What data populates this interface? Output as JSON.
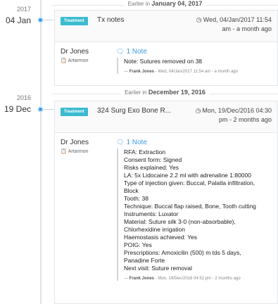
{
  "groups": [
    {
      "year": "2017",
      "day": "04 Jan",
      "separator_prefix": "Earlier in",
      "separator_date": "January 04, 2017",
      "entry": {
        "badge": "Treatment",
        "title": "Tx notes",
        "time_line1": "Wed, 04/Jan/2017 11:54",
        "time_line2": "am - a month ago",
        "author": "Dr Jones",
        "location": "Artarmon",
        "note_count": "1 Note",
        "note_lines": [
          "Note: Sutures removed on 38"
        ],
        "note_author": "Frank Jones",
        "note_meta": " - Wed, 04/Jan/2017 11:54 am - a month ago"
      }
    },
    {
      "year": "2016",
      "day": "19 Dec",
      "separator_prefix": "Earlier in",
      "separator_date": "December 19, 2016",
      "entry": {
        "badge": "Treatment",
        "title": "324 Surg Exo Bone R...",
        "time_line1": "Mon, 19/Dec/2016 04:30",
        "time_line2": "pm - 2 months ago",
        "author": "Dr Jones",
        "location": "Artarmon",
        "note_count": "1 Note",
        "note_lines": [
          "RFA: Extraction",
          "Consent form: Signed",
          "Risks explained: Yes",
          "LA: 5x Lidocaine 2.2 ml with adrenaline 1:80000",
          "Type of injection given: Buccal, Palatla infiltration,",
          "Block",
          "Tooth: 38",
          "Technique: Buccal flap raised, Bone, Tooth cutting",
          "Instruments: Luxator",
          "Material: Suture silk 3-0 (non-absorbable),",
          "Chlorhexidine irrigation",
          "Haemostasis achieved: Yes",
          "POIG: Yes",
          "Prescriptions: Amoxicilin (500) m tds 5 days,",
          "Panadine Forte",
          "Next visit: Suture removal"
        ],
        "note_author": "Frank Jones",
        "note_meta": " - Mon, 19/Dec/2016 04:52 pm - 2 months ago"
      }
    }
  ]
}
